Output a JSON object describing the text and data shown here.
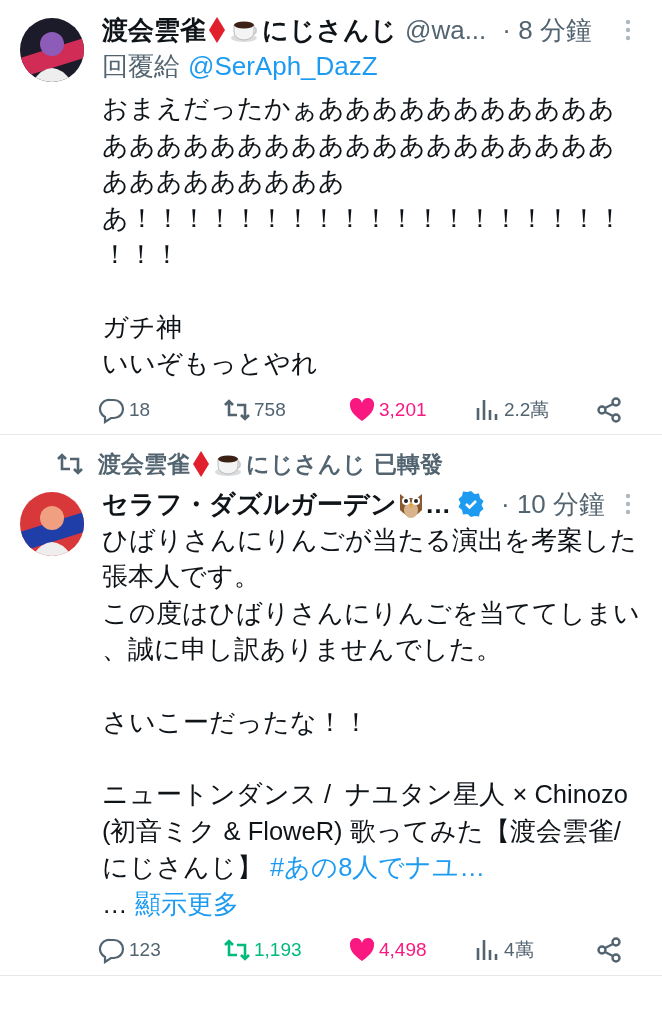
{
  "tweets": [
    {
      "author": {
        "name": "渡会雲雀",
        "badges": [
          {
            "kind": "diamond"
          },
          {
            "kind": "coffee"
          }
        ],
        "name_suffix": "にじさんじ",
        "handle": "@wa...",
        "verified": false
      },
      "time": "· 8 分鐘",
      "reply_to": {
        "label": "回覆給",
        "handle": "@SerAph_DazZ"
      },
      "body": [
        [
          "おまえだったかぁあああああああああああああああああああああああああああああああああああああああ",
          "あ！！！！！！！！！！！！！！！！！！！！！！"
        ],
        [
          "ガチ神",
          "いいぞもっとやれ"
        ]
      ],
      "stats": {
        "replies": "18",
        "retweets": {
          "count": "758",
          "active": false
        },
        "likes": {
          "count": "3,201",
          "active": true
        },
        "views": "2.2萬"
      }
    },
    {
      "retweeted_by": {
        "name": "渡会雲雀",
        "badges": [
          {
            "kind": "diamond"
          },
          {
            "kind": "coffee"
          }
        ],
        "name_suffix": "にじさんじ",
        "action": "已轉發"
      },
      "author": {
        "name": "セラフ・ダズルガーデン",
        "badges": [
          {
            "kind": "owl"
          }
        ],
        "name_suffix": "…",
        "verified": true
      },
      "time": "· 10 分鐘",
      "body": [
        [
          "ひばりさんにりんごが当たる演出を考案した張本人です。",
          "この度はひばりさんにりんごを当ててしまい、誠に申し訳ありませんでした。"
        ],
        [
          "さいこーだったな！！"
        ],
        [
          "ニュートンダンス /  ナユタン星人 × Chinozo (初音ミク & FloweR) 歌ってみた【渡会雲雀/にじさんじ】 "
        ]
      ],
      "hashtag": "#あの8人でナユ…",
      "show_more": {
        "prefix": "… ",
        "label": "顯示更多"
      },
      "stats": {
        "replies": "123",
        "retweets": {
          "count": "1,193",
          "active": true
        },
        "likes": {
          "count": "4,498",
          "active": true
        },
        "views": "4萬"
      }
    }
  ]
}
